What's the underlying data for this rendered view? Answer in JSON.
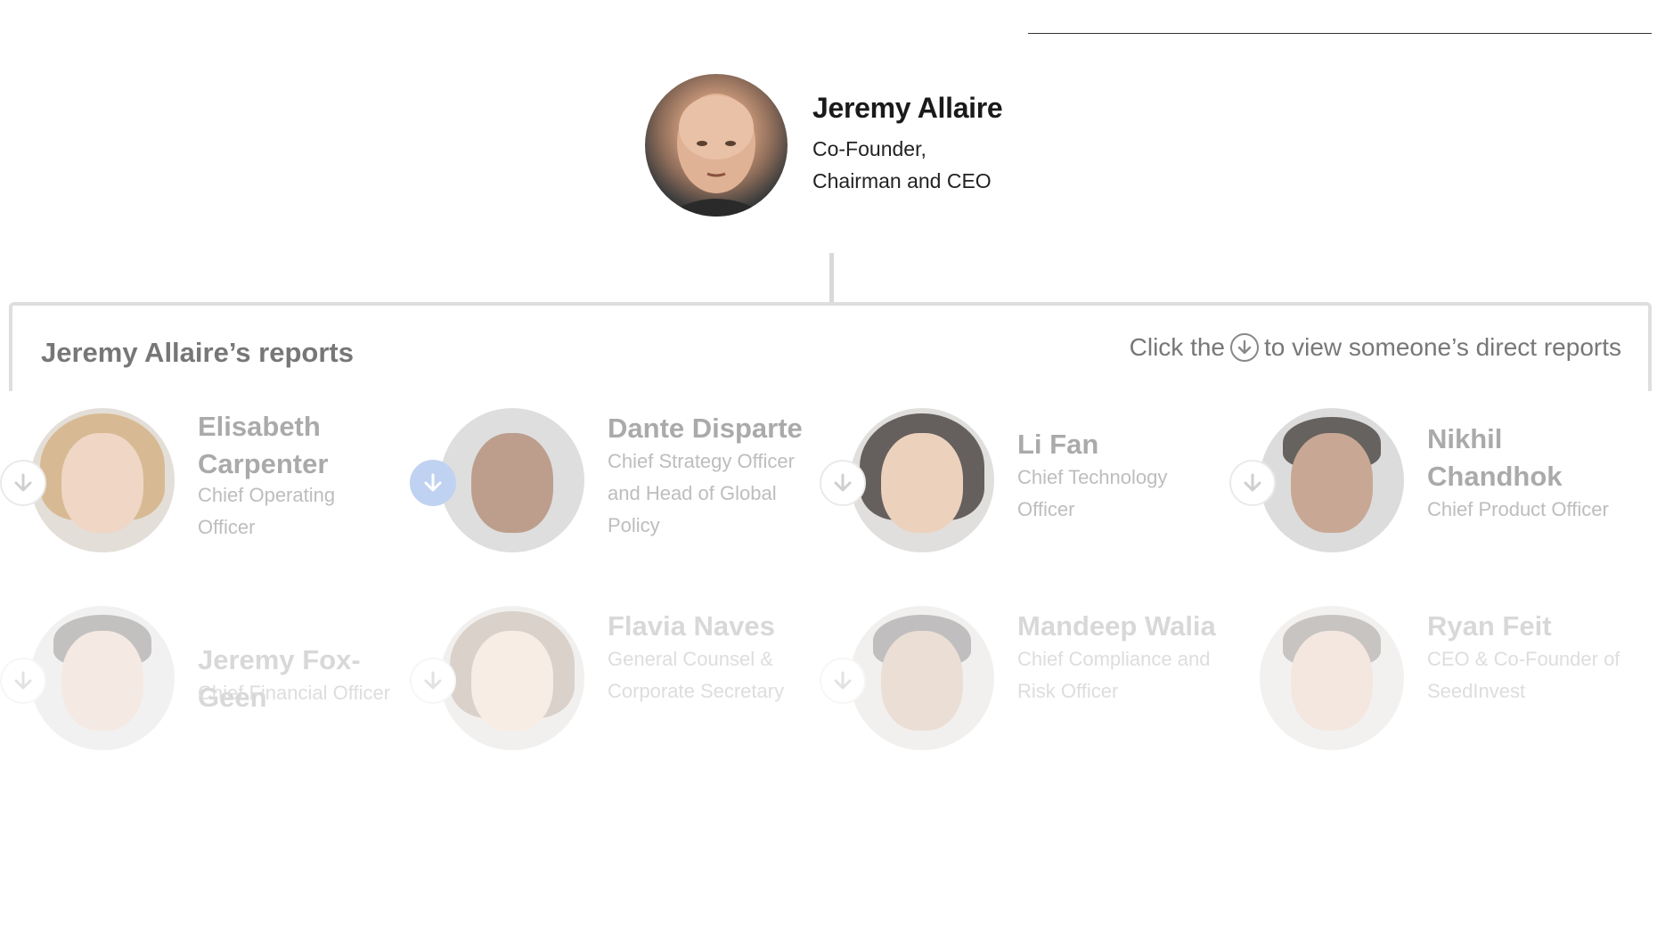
{
  "top": {
    "name": "Jeremy Allaire",
    "title_line1": "Co-Founder,",
    "title_line2": "Chairman and CEO"
  },
  "reports_heading": "Jeremy Allaire’s reports",
  "hint": {
    "before": "Click the",
    "after": "to view someone’s direct reports"
  },
  "reports": [
    {
      "name_line1": "Elisabeth",
      "name_line2": "Carpenter",
      "title_line1": "Chief Operating",
      "title_line2": "Officer",
      "title_line3": ""
    },
    {
      "name_line1": "Dante Disparte",
      "name_line2": "",
      "title_line1": "Chief Strategy Officer",
      "title_line2": "and Head of Global",
      "title_line3": "Policy"
    },
    {
      "name_line1": "Li Fan",
      "name_line2": "",
      "title_line1": "Chief Technology",
      "title_line2": "Officer",
      "title_line3": ""
    },
    {
      "name_line1": "Nikhil",
      "name_line2": "Chandhok",
      "title_line1": "Chief Product Officer",
      "title_line2": "",
      "title_line3": ""
    },
    {
      "name_line1": "Jeremy Fox-Geen",
      "name_line2": "",
      "title_line1": "Chief Financial Officer",
      "title_line2": "",
      "title_line3": ""
    },
    {
      "name_line1": "Flavia Naves",
      "name_line2": "",
      "title_line1": "General Counsel &",
      "title_line2": "Corporate Secretary",
      "title_line3": ""
    },
    {
      "name_line1": "Mandeep Walia",
      "name_line2": "",
      "title_line1": "Chief Compliance and",
      "title_line2": "Risk Officer",
      "title_line3": ""
    },
    {
      "name_line1": "Ryan Feit",
      "name_line2": "",
      "title_line1": "CEO & Co-Founder of",
      "title_line2": "SeedInvest",
      "title_line3": ""
    }
  ],
  "colors": {
    "active_expand": "#a9c2ec",
    "connector": "#d9d9d9"
  }
}
